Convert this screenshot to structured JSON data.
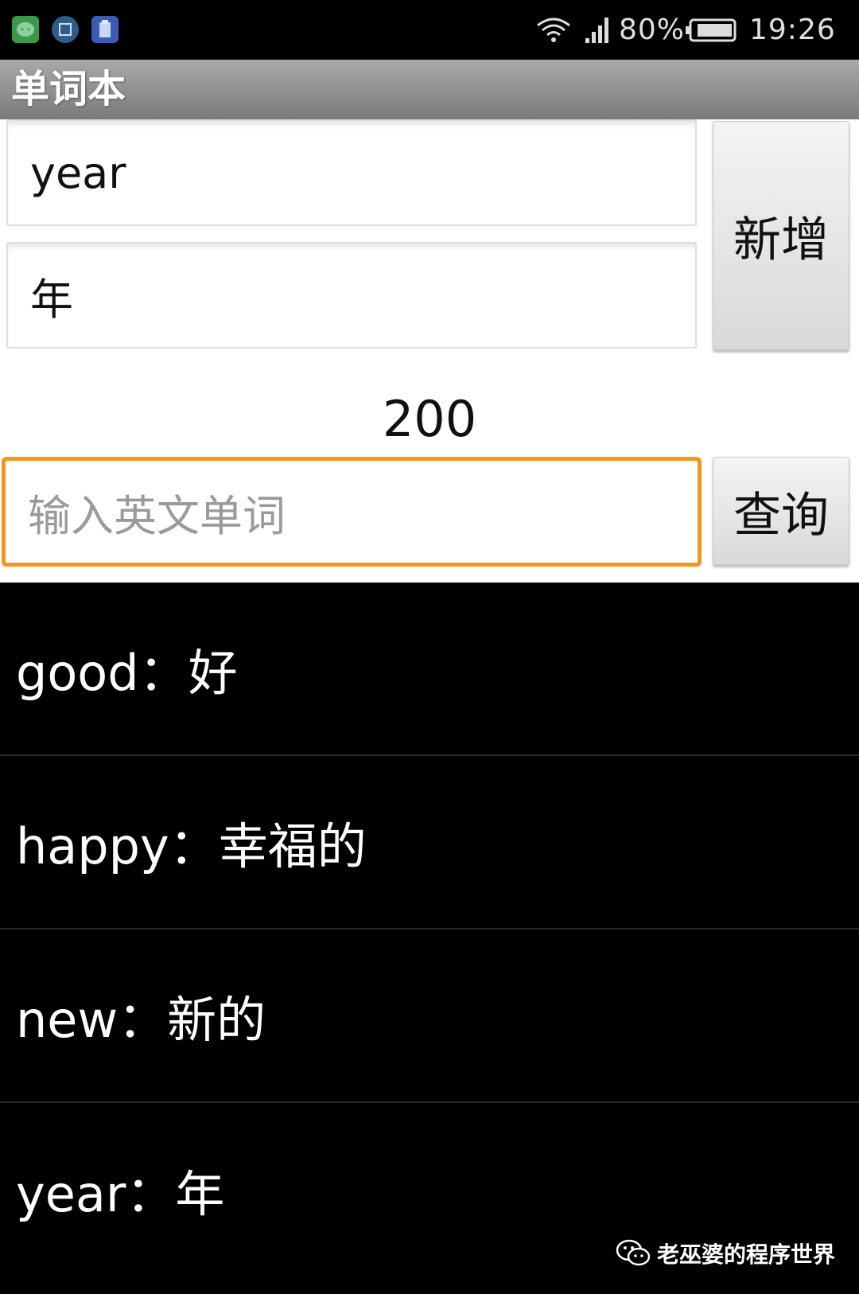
{
  "status_bar": {
    "battery_percent": "80%",
    "time": "19:26",
    "notification_icons": [
      "wechat-icon",
      "gallery-icon",
      "clipboard-icon"
    ],
    "status_icons": [
      "wifi-icon",
      "signal-icon",
      "battery-icon"
    ]
  },
  "app": {
    "title": "单词本"
  },
  "form": {
    "english_value": "year",
    "chinese_value": "年",
    "add_button_label": "新增",
    "count": "200",
    "search_placeholder": "输入英文单词",
    "search_button_label": "查询"
  },
  "word_list": {
    "items": [
      {
        "text": "good：好"
      },
      {
        "text": "happy：幸福的"
      },
      {
        "text": "new：新的"
      },
      {
        "text": "year：年"
      }
    ]
  },
  "watermark": {
    "text": "老巫婆的程序世界"
  },
  "colors": {
    "focus_border": "#f7941d",
    "titlebar": "#8c8c8c",
    "list_background": "#000000"
  }
}
